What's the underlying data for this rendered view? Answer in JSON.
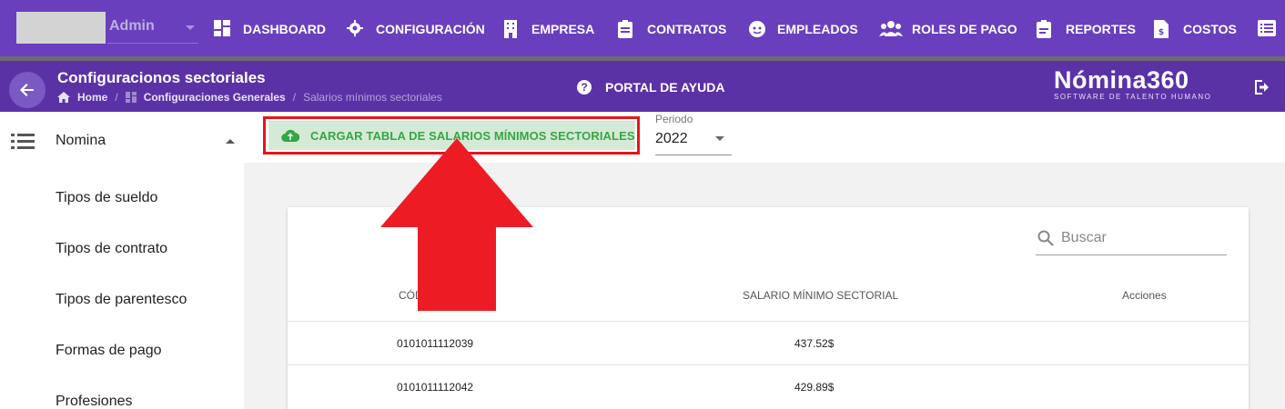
{
  "topbar": {
    "user": "Admin",
    "nav": [
      {
        "label": "DASHBOARD",
        "icon": "dashboard-icon"
      },
      {
        "label": "CONFIGURACIÓN",
        "icon": "gear-icon"
      },
      {
        "label": "EMPRESA",
        "icon": "building-icon"
      },
      {
        "label": "CONTRATOS",
        "icon": "clipboard-icon"
      },
      {
        "label": "EMPLEADOS",
        "icon": "face-icon"
      },
      {
        "label": "ROLES DE PAGO",
        "icon": "people-icon"
      },
      {
        "label": "REPORTES",
        "icon": "report-icon"
      },
      {
        "label": "COSTOS",
        "icon": "invoice-icon"
      }
    ]
  },
  "header": {
    "title": "Configuracionos sectoriales",
    "breadcrumb": [
      "Home",
      "Configuraciones Generales",
      "Salarios mínimos sectoriales"
    ],
    "help": "PORTAL DE AYUDA",
    "brand": "Nómina360",
    "brand_tagline": "SOFTWARE DE TALENTO HUMANO"
  },
  "sidebar": {
    "section": "Nomina",
    "items": [
      "Tipos de sueldo",
      "Tipos de contrato",
      "Tipos de parentesco",
      "Formas de pago",
      "Profesiones"
    ]
  },
  "toolbar": {
    "upload_label": "CARGAR TABLA DE SALARIOS MÍNIMOS SECTORIALES",
    "period_label": "Periodo",
    "period_value": "2022"
  },
  "table": {
    "search_placeholder": "Buscar",
    "columns": [
      "CÓD",
      "SALARIO MÍNIMO SECTORIAL",
      "Acciones"
    ],
    "rows": [
      {
        "code": "0101011112039",
        "salary": "437.52$"
      },
      {
        "code": "0101011112042",
        "salary": "429.89$"
      }
    ]
  },
  "colors": {
    "nav_purple": "#6a3fbd",
    "header_purple": "#5b32a6",
    "upload_green": "#36a548",
    "highlight_red": "#e8141b"
  }
}
